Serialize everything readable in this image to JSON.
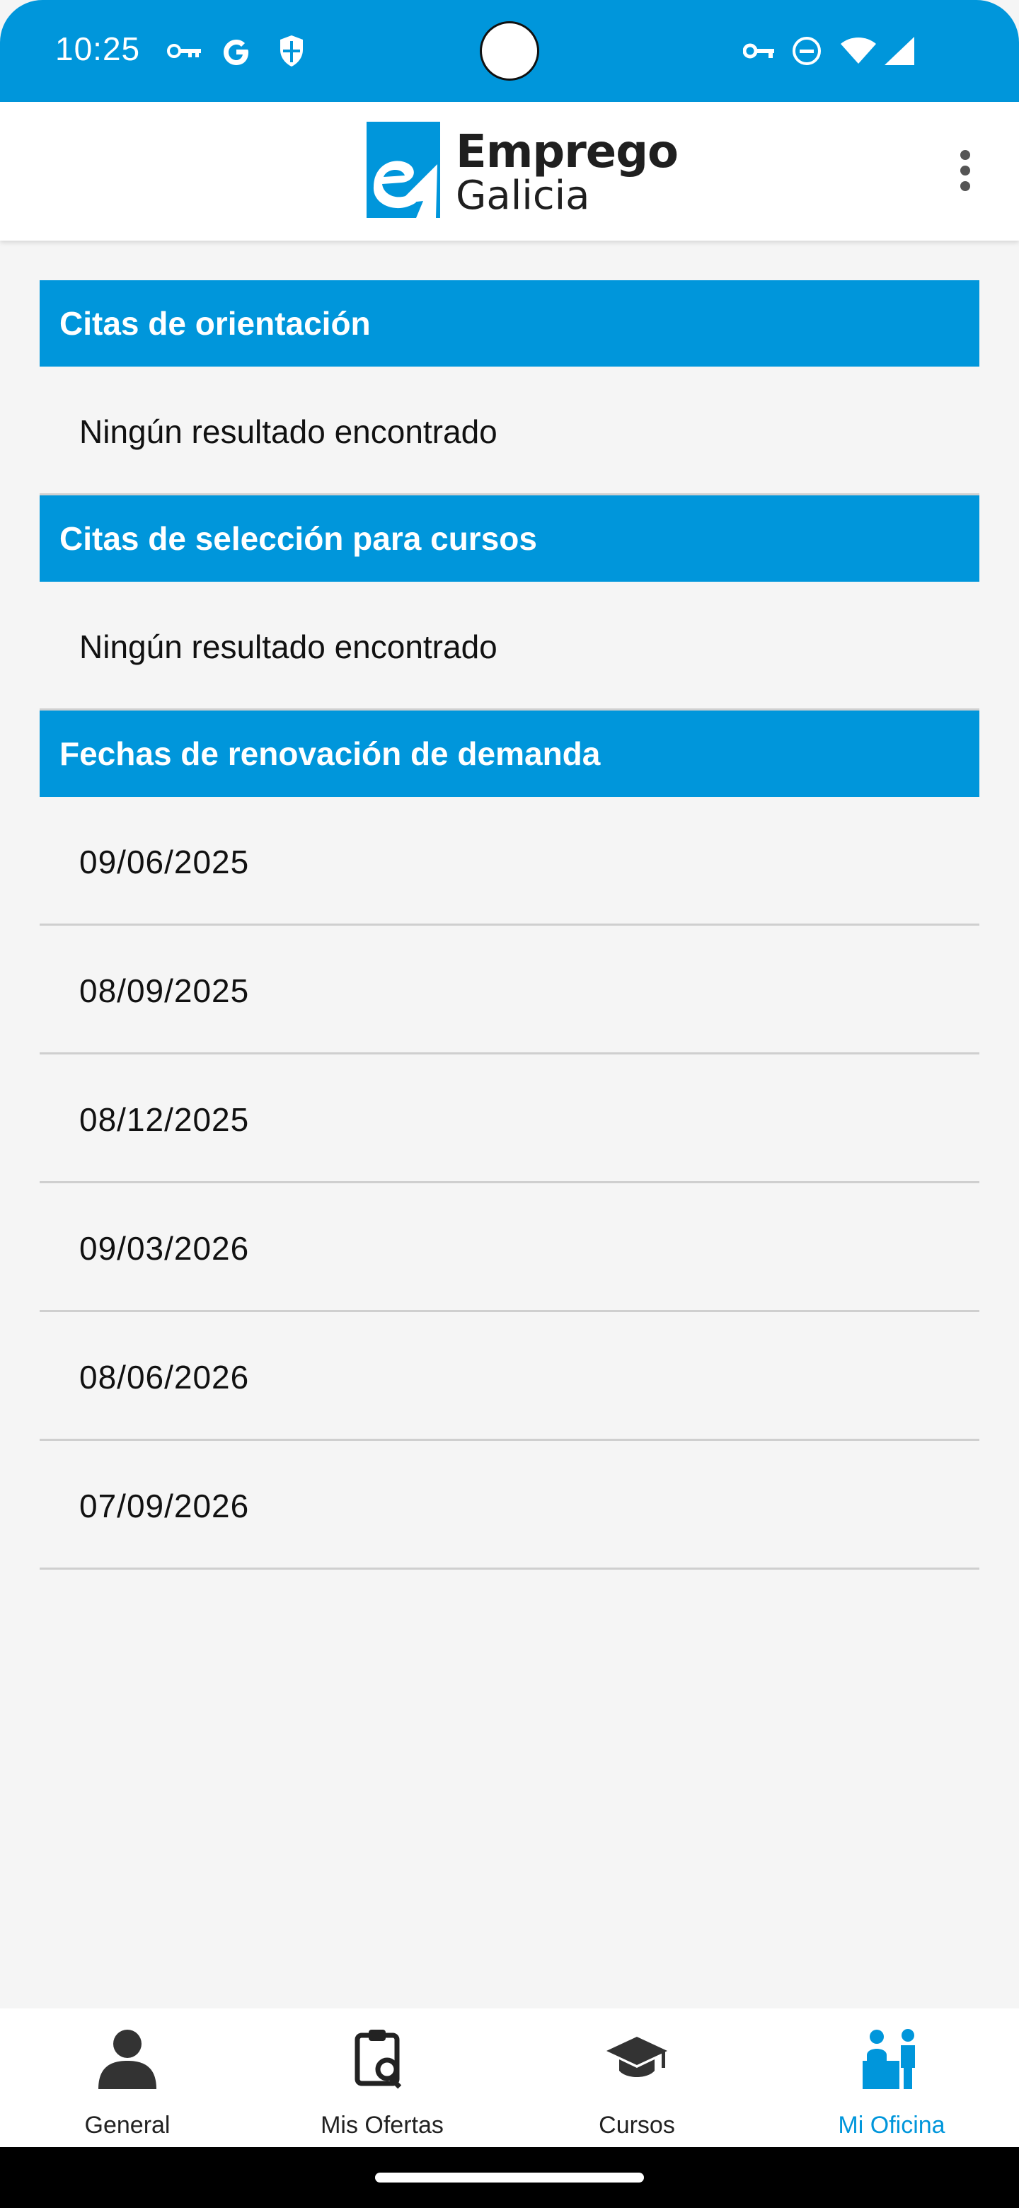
{
  "status_bar": {
    "time": "10:25",
    "icons": [
      "key-icon",
      "google-icon",
      "shield-icon",
      "vpn-key-icon",
      "do-not-disturb-icon",
      "wifi-icon",
      "signal-icon"
    ]
  },
  "app_bar": {
    "logo_line1": "Emprego",
    "logo_line2": "Galicia",
    "menu_icon": "overflow-menu-icon"
  },
  "sections": {
    "orientacion": {
      "title": "Citas de orientación",
      "empty": "Ningún resultado encontrado"
    },
    "seleccion": {
      "title": "Citas de selección para cursos",
      "empty": "Ningún resultado encontrado"
    },
    "renovacion": {
      "title": "Fechas de renovación de demanda",
      "dates": [
        "09/06/2025",
        "08/09/2025",
        "08/12/2025",
        "09/03/2026",
        "08/06/2026",
        "07/09/2026"
      ]
    }
  },
  "bottom_nav": {
    "items": [
      {
        "label": "General",
        "icon": "person-icon"
      },
      {
        "label": "Mis Ofertas",
        "icon": "clipboard-search-icon"
      },
      {
        "label": "Cursos",
        "icon": "graduation-cap-icon"
      },
      {
        "label": "Mi Oficina",
        "icon": "office-desk-icon"
      }
    ],
    "active": "Mi Oficina"
  },
  "colors": {
    "brand": "#0096db",
    "background": "#f5f5f5"
  }
}
